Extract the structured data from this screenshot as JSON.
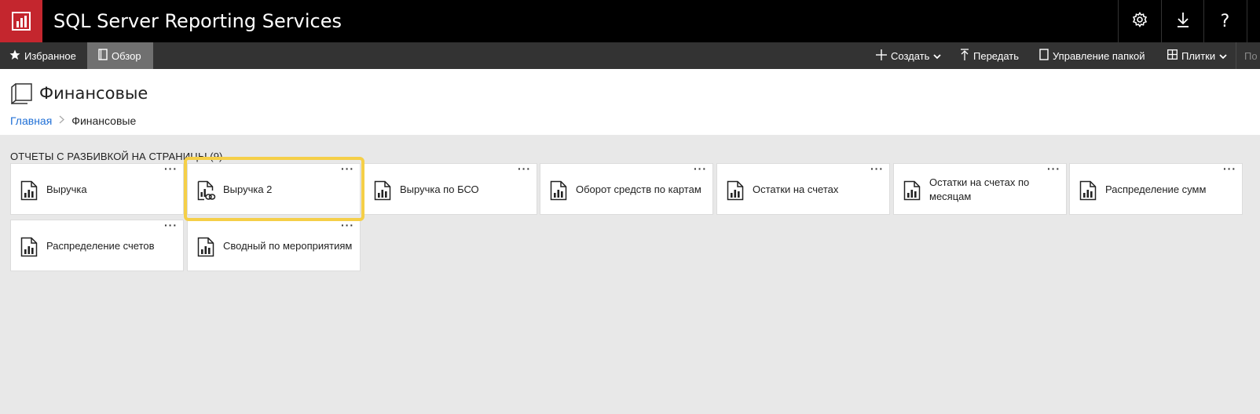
{
  "header": {
    "app_title": "SQL Server Reporting Services",
    "logo_icon": "ssrs-report-logo-icon",
    "brand_color": "#c4262e",
    "settings_icon": "gear-icon",
    "download_icon": "download-arrow-icon",
    "help_label": "?"
  },
  "toolbar": {
    "favorites_label": "Избранное",
    "browse_label": "Обзор",
    "create_label": "Создать",
    "upload_label": "Передать",
    "manage_folder_label": "Управление папкой",
    "tiles_label": "Плитки",
    "search_placeholder": "По"
  },
  "page": {
    "title": "Финансовые",
    "breadcrumb": [
      {
        "label": "Главная"
      },
      {
        "label": "Финансовые"
      }
    ]
  },
  "section": {
    "title": "ОТЧЕТЫ С РАЗБИВКОЙ НА СТРАНИЦЫ (9)"
  },
  "reports": [
    {
      "label": "Выручка",
      "more": "···"
    },
    {
      "label": "Выручка 2",
      "more": "···",
      "icon": "shared-report-icon",
      "highlighted": true
    },
    {
      "label": "Выручка по БСО",
      "more": "···"
    },
    {
      "label": "Оборот средств по картам",
      "more": "···"
    },
    {
      "label": "Остатки на счетах",
      "more": "···"
    },
    {
      "label": "Остатки на счетах по месяцам",
      "more": "···"
    },
    {
      "label": "Распределение сумм",
      "more": "···"
    },
    {
      "label": "Распределение счетов",
      "more": "···"
    },
    {
      "label": "Сводный по мероприятиям",
      "more": "···"
    }
  ],
  "colors": {
    "highlight": "#f5cf48",
    "link": "#1f6fd6"
  }
}
